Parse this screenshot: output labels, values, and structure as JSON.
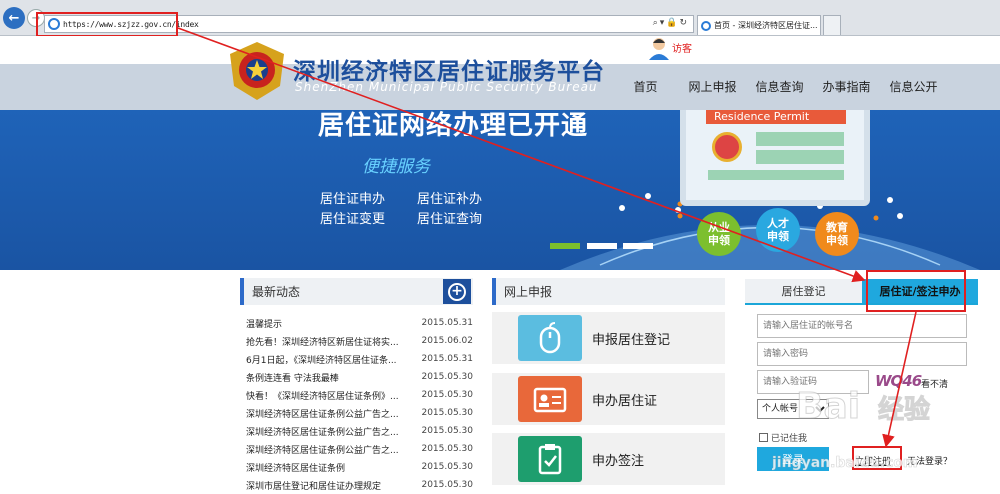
{
  "browser": {
    "url": "https://www.szjzz.gov.cn/index",
    "tab_title": "首页 - 深圳经济特区居住证...",
    "tab_close": "×",
    "addr_controls": "⌕▾🔒↻"
  },
  "user": {
    "visitor": "访客"
  },
  "header": {
    "title": "深圳经济特区居住证服务平台",
    "subtitle": "ShenZhen Municipal Public Security Bureau",
    "nav": [
      "首页",
      "网上申报",
      "信息查询",
      "办事指南",
      "信息公开"
    ]
  },
  "banner": {
    "title": "居住证网络办理已开通",
    "subtitle": "便捷服务",
    "links": [
      "居住证申办",
      "居住证补办",
      "居住证变更",
      "居住证查询"
    ],
    "mockup_label": "Residence Permit",
    "circles": [
      {
        "label": "从业\n申领",
        "color": "#7cbf2e"
      },
      {
        "label": "人才\n申领",
        "color": "#2aa8e0"
      },
      {
        "label": "教育\n申领",
        "color": "#f08a1c"
      }
    ]
  },
  "news": {
    "title": "最新动态",
    "items": [
      {
        "title": "温馨提示",
        "date": "2015.05.31"
      },
      {
        "title": "抢先看！深圳经济特区新居住证将实...",
        "date": "2015.06.02"
      },
      {
        "title": "6月1日起，《深圳经济特区居住证条...",
        "date": "2015.05.31"
      },
      {
        "title": "条例连连看 守法我最棒",
        "date": "2015.05.30"
      },
      {
        "title": "快看！《深圳经济特区居住证条例》...",
        "date": "2015.05.30"
      },
      {
        "title": "深圳经济特区居住证条例公益广告之...",
        "date": "2015.05.30"
      },
      {
        "title": "深圳经济特区居住证条例公益广告之...",
        "date": "2015.05.30"
      },
      {
        "title": "深圳经济特区居住证条例公益广告之...",
        "date": "2015.05.30"
      },
      {
        "title": "深圳经济特区居住证条例",
        "date": "2015.05.30"
      },
      {
        "title": "深圳市居住登记和居住证办理规定",
        "date": "2015.05.30"
      }
    ]
  },
  "apply": {
    "title": "网上申报",
    "items": [
      {
        "label": "申报居住登记",
        "color": "#5bbde0"
      },
      {
        "label": "申办居住证",
        "color": "#e8683a"
      },
      {
        "label": "申办签注",
        "color": "#1e9e6e"
      }
    ]
  },
  "login": {
    "tabs": [
      "居住登记",
      "居住证/签注申办"
    ],
    "account_placeholder": "请输入居住证的帐号名",
    "password_placeholder": "请输入密码",
    "captcha_placeholder": "请输入验证码",
    "captcha_text": "WQ46",
    "captcha_refresh": "看不清",
    "account_type": "个人帐号",
    "remember": "已记住我",
    "login_button": "登录",
    "register": "立即注册",
    "forgot": "无法登录？"
  },
  "watermark": {
    "brand": "Bai",
    "brand2": "经验",
    "site": "jingyan.baidu.com"
  },
  "colors": {
    "accent": "#1d4f9c",
    "tab_active": "#1fa8de",
    "highlight": "#e02020"
  }
}
